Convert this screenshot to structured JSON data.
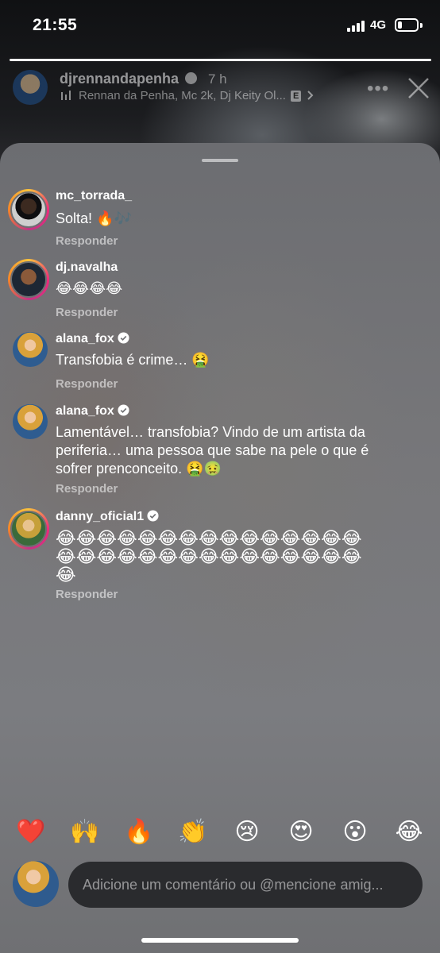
{
  "status_bar": {
    "time": "21:55",
    "network": "4G",
    "battery_level": 0.2
  },
  "story": {
    "username": "djrennandapenha",
    "time_ago": "7 h",
    "music": "Rennan da Penha, Mc 2k, Dj Keity Ol...",
    "explicit_badge": "E",
    "more_label": "•••",
    "progress": 1.0,
    "icons": [
      "verified-icon",
      "music-bars-icon",
      "chevron-right-icon",
      "more-icon",
      "close-icon"
    ]
  },
  "comments": [
    {
      "username": "mc_torrada_",
      "verified": false,
      "text": "Solta! 🔥🎶",
      "reply": "Responder"
    },
    {
      "username": "dj.navalha",
      "verified": false,
      "text": "😂😂😂😂",
      "reply": "Responder"
    },
    {
      "username": "alana_fox",
      "verified": true,
      "text": "Transfobia é crime… 🤮",
      "reply": "Responder"
    },
    {
      "username": "alana_fox",
      "verified": true,
      "text": "Lamentável… transfobia? Vindo de um artista da periferia… uma pessoa que sabe na pele o que é sofrer prenconceito. 🤮🤢",
      "reply": "Responder"
    },
    {
      "username": "danny_oficial1",
      "verified": true,
      "text": "😂😂😂😂😂😂😂😂😂😂😂😂😂😂😂😂😂😂😂😂😂😂😂😂😂😂😂😂😂😂😂",
      "reply": "Responder"
    }
  ],
  "reactions": [
    "❤️",
    "🙌",
    "🔥",
    "👏",
    "😢",
    "😍",
    "😮",
    "😂"
  ],
  "input": {
    "placeholder": "Adicione um comentário ou @mencione amig..."
  },
  "colors": {
    "sheet": "#757679",
    "input_bg": "#2a2b2e",
    "ring_gradient": [
      "#f9c23c",
      "#ee2a7b",
      "#c13584"
    ]
  }
}
